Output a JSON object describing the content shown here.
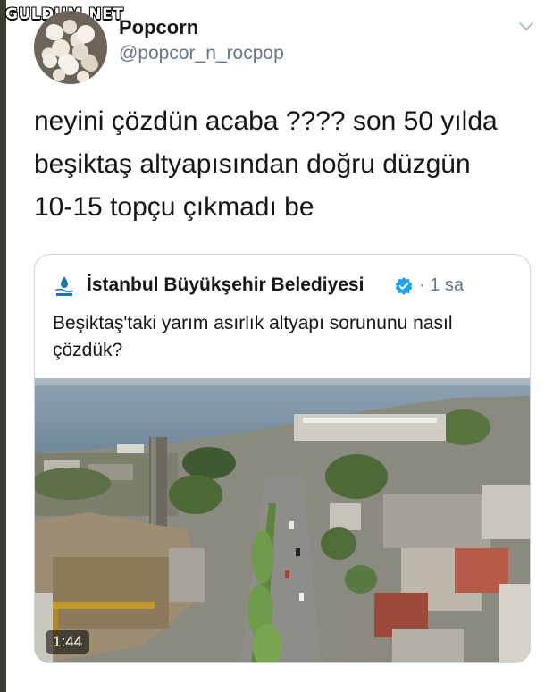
{
  "watermark": "GULDUM.NET",
  "tweet": {
    "author": {
      "display_name": "Popcorn",
      "handle": "@popcor_n_rocpop",
      "avatar_icon": "popcorn-avatar"
    },
    "text_lines": [
      "neyini çözdün acaba ???? son 50 yılda",
      "beşiktaş altyapısından doğru düzgün",
      "10-15 topçu çıkmadı be"
    ],
    "menu_icon": "chevron-down-icon"
  },
  "quoted_tweet": {
    "author_name": "İstanbul Büyükşehir Belediyesi",
    "time": "· 1 sa",
    "verified_icon": "verified-badge-icon",
    "text": "Beşiktaş'taki yarım asırlık altyapı sorununu nasıl çözdük?",
    "media": {
      "type": "video",
      "duration": "1:44"
    }
  },
  "colors": {
    "text": "#14171a",
    "secondary": "#657786",
    "border": "#ccd6dd",
    "verified": "#1da1f2"
  }
}
